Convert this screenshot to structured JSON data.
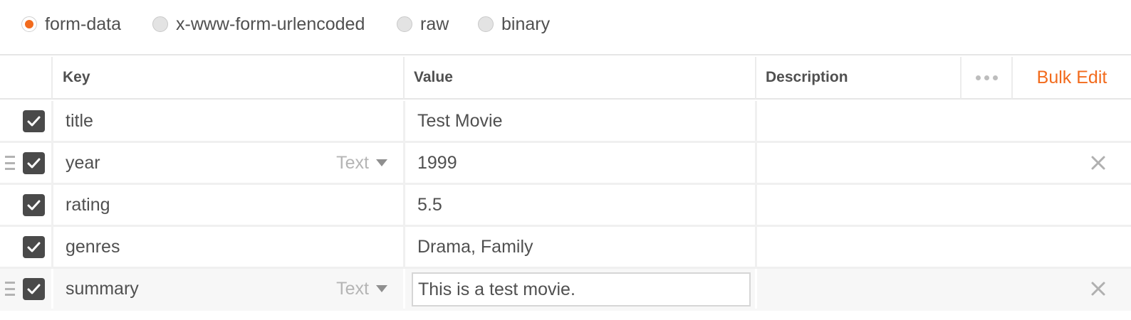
{
  "body_types": [
    {
      "label": "form-data",
      "selected": true
    },
    {
      "label": "x-www-form-urlencoded",
      "selected": false
    },
    {
      "label": "raw",
      "selected": false
    },
    {
      "label": "binary",
      "selected": false
    }
  ],
  "table": {
    "headers": {
      "key": "Key",
      "value": "Value",
      "description": "Description",
      "bulk_edit": "Bulk Edit"
    },
    "rows": [
      {
        "key": "title",
        "value": "Test Movie",
        "type": "",
        "checked": true
      },
      {
        "key": "year",
        "value": "1999",
        "type": "Text",
        "checked": true
      },
      {
        "key": "rating",
        "value": "5.5",
        "type": "",
        "checked": true
      },
      {
        "key": "genres",
        "value": "Drama, Family",
        "type": "",
        "checked": true
      },
      {
        "key": "summary",
        "value": "This is a test movie.",
        "type": "Text",
        "checked": true
      }
    ]
  },
  "colors": {
    "accent": "#f26b1d",
    "text": "#505050",
    "checkbox": "#4a4a4a"
  },
  "icons": {
    "more": "more-horizontal-icon",
    "close": "close-icon",
    "drag": "drag-handle-icon",
    "check": "checkmark-icon",
    "caret": "caret-down-icon"
  }
}
